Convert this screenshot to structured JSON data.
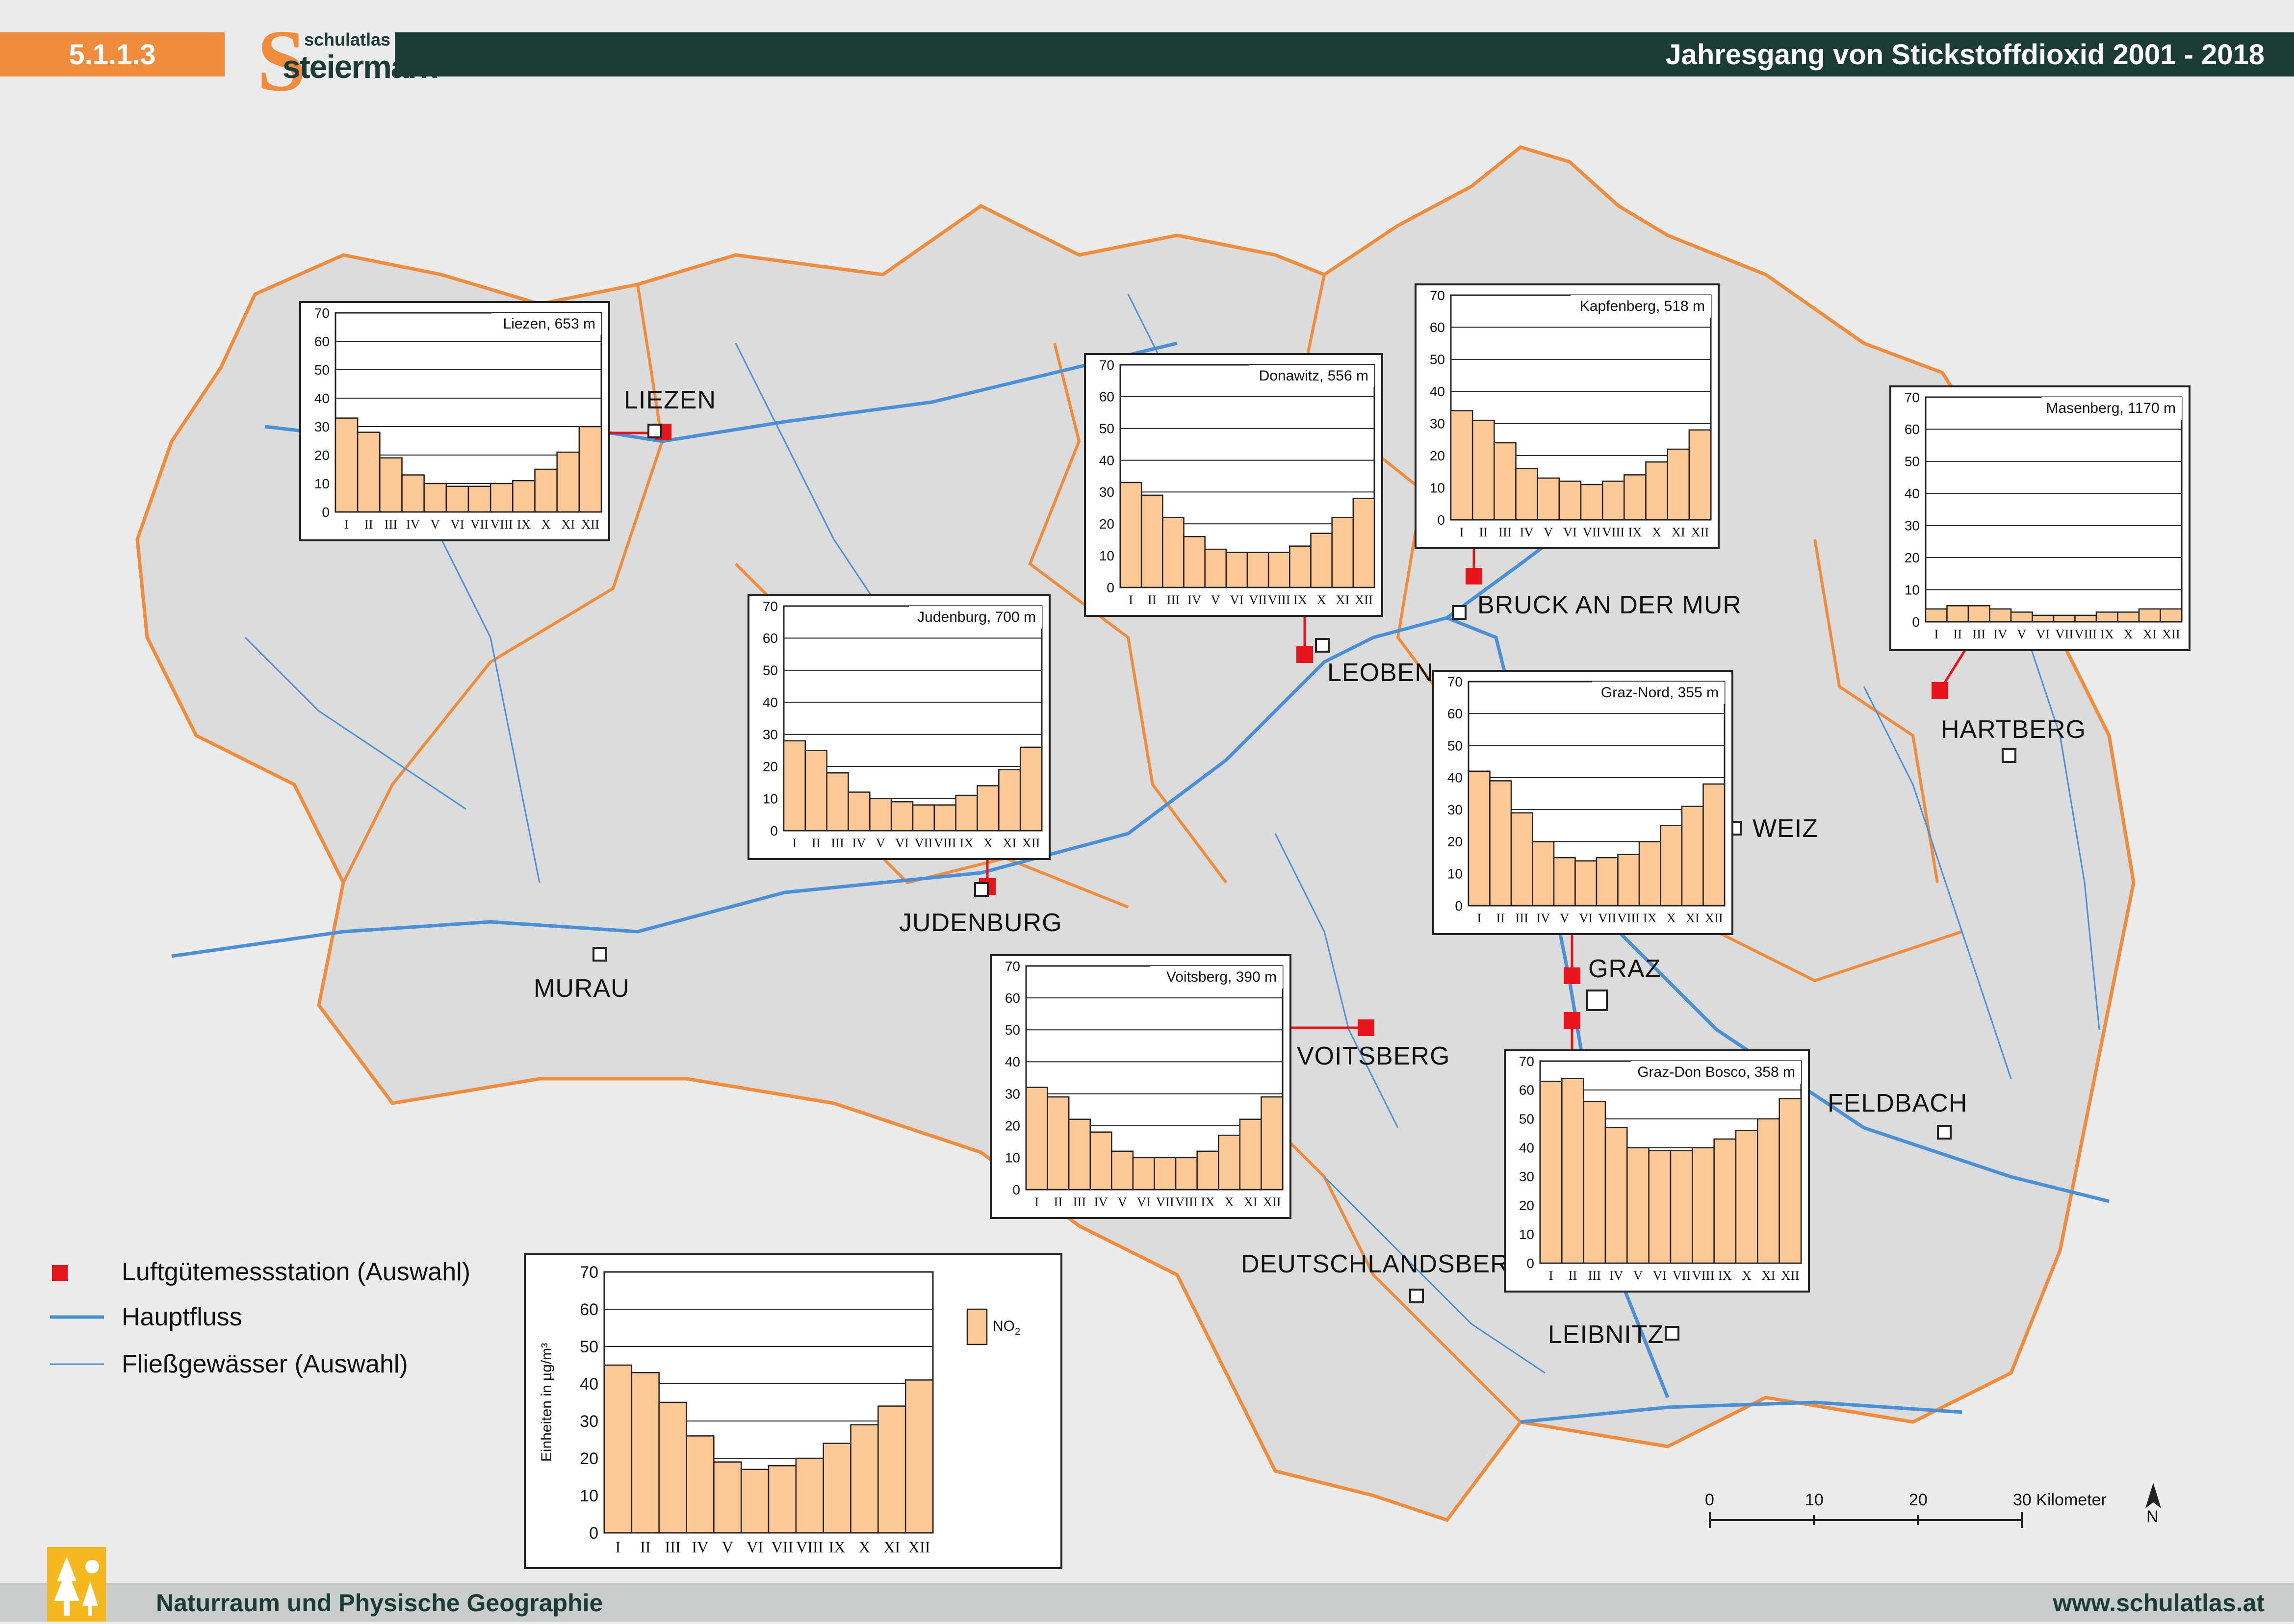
{
  "header": {
    "code": "5.1.1.3",
    "logo_small": "schulatlas",
    "logo_big": "steiermark",
    "title": "Jahresgang von Stickstoffdioxid 2001 - 2018"
  },
  "footer": {
    "left": "Naturraum und Physische Geographie",
    "right": "www.schulatlas.at"
  },
  "colors": {
    "header_orange": "#f08c3c",
    "header_dark": "#1a3c34",
    "bar_fill": "#fbc896",
    "bar_stroke": "#222222",
    "station_red": "#e8141c",
    "river_blue": "#4a90d9",
    "border_orange": "#f08c3c"
  },
  "places": {
    "liezen": "LIEZEN",
    "bruck": "BRUCK AN DER MUR",
    "leoben": "LEOBEN",
    "hartberg": "HARTBERG",
    "weiz": "WEIZ",
    "judenburg": "JUDENBURG",
    "murau": "MURAU",
    "graz": "GRAZ",
    "voitsberg": "VOITSBERG",
    "feldbach": "FELDBACH",
    "deutschlandsberg": "DEUTSCHLANDSBERG",
    "leibnitz": "LEIBNITZ"
  },
  "legend": {
    "station": "Luftgütemessstation (Auswahl)",
    "main_river": "Hauptfluss",
    "streams": "Fließgewässer (Auswahl)",
    "series_label": "NO",
    "series_sub": "2",
    "ylabel": "Einheiten in µg/m³"
  },
  "scale": {
    "ticks": [
      "0",
      "10",
      "20",
      "30 Kilometer"
    ],
    "north": "N"
  },
  "chart_data": [
    {
      "type": "bar",
      "title": "Liezen, 653 m",
      "categories": [
        "I",
        "II",
        "III",
        "IV",
        "V",
        "VI",
        "VII",
        "VIII",
        "IX",
        "X",
        "XI",
        "XII"
      ],
      "values": [
        33,
        28,
        19,
        13,
        10,
        9,
        9,
        10,
        11,
        15,
        21,
        30
      ],
      "ylim": [
        0,
        70
      ],
      "yticks": [
        "0",
        "10",
        "20",
        "30",
        "40",
        "50",
        "60",
        "70"
      ]
    },
    {
      "type": "bar",
      "title": "Donawitz, 556 m",
      "categories": [
        "I",
        "II",
        "III",
        "IV",
        "V",
        "VI",
        "VII",
        "VIII",
        "IX",
        "X",
        "XI",
        "XII"
      ],
      "values": [
        33,
        29,
        22,
        16,
        12,
        11,
        11,
        11,
        13,
        17,
        22,
        28
      ],
      "ylim": [
        0,
        70
      ],
      "yticks": [
        "0",
        "10",
        "20",
        "30",
        "40",
        "50",
        "60",
        "70"
      ]
    },
    {
      "type": "bar",
      "title": "Kapfenberg, 518 m",
      "categories": [
        "I",
        "II",
        "III",
        "IV",
        "V",
        "VI",
        "VII",
        "VIII",
        "IX",
        "X",
        "XI",
        "XII"
      ],
      "values": [
        34,
        31,
        24,
        16,
        13,
        12,
        11,
        12,
        14,
        18,
        22,
        28
      ],
      "ylim": [
        0,
        70
      ],
      "yticks": [
        "0",
        "10",
        "20",
        "30",
        "40",
        "50",
        "60",
        "70"
      ]
    },
    {
      "type": "bar",
      "title": "Masenberg, 1170 m",
      "categories": [
        "I",
        "II",
        "III",
        "IV",
        "V",
        "VI",
        "VII",
        "VIII",
        "IX",
        "X",
        "XI",
        "XII"
      ],
      "values": [
        4,
        5,
        5,
        4,
        3,
        2,
        2,
        2,
        3,
        3,
        4,
        4
      ],
      "ylim": [
        0,
        70
      ],
      "yticks": [
        "0",
        "10",
        "20",
        "30",
        "40",
        "50",
        "60",
        "70"
      ]
    },
    {
      "type": "bar",
      "title": "Judenburg, 700 m",
      "categories": [
        "I",
        "II",
        "III",
        "IV",
        "V",
        "VI",
        "VII",
        "VIII",
        "IX",
        "X",
        "XI",
        "XII"
      ],
      "values": [
        28,
        25,
        18,
        12,
        10,
        9,
        8,
        8,
        11,
        14,
        19,
        26
      ],
      "ylim": [
        0,
        70
      ],
      "yticks": [
        "0",
        "10",
        "20",
        "30",
        "40",
        "50",
        "60",
        "70"
      ]
    },
    {
      "type": "bar",
      "title": "Graz-Nord, 355 m",
      "categories": [
        "I",
        "II",
        "III",
        "IV",
        "V",
        "VI",
        "VII",
        "VIII",
        "IX",
        "X",
        "XI",
        "XII"
      ],
      "values": [
        42,
        39,
        29,
        20,
        15,
        14,
        15,
        16,
        20,
        25,
        31,
        38
      ],
      "ylim": [
        0,
        70
      ],
      "yticks": [
        "0",
        "10",
        "20",
        "30",
        "40",
        "50",
        "60",
        "70"
      ]
    },
    {
      "type": "bar",
      "title": "Voitsberg, 390 m",
      "categories": [
        "I",
        "II",
        "III",
        "IV",
        "V",
        "VI",
        "VII",
        "VIII",
        "IX",
        "X",
        "XI",
        "XII"
      ],
      "values": [
        32,
        29,
        22,
        18,
        12,
        10,
        10,
        10,
        12,
        17,
        22,
        29
      ],
      "ylim": [
        0,
        70
      ],
      "yticks": [
        "0",
        "10",
        "20",
        "30",
        "40",
        "50",
        "60",
        "70"
      ]
    },
    {
      "type": "bar",
      "title": "Graz-Don Bosco, 358 m",
      "categories": [
        "I",
        "II",
        "III",
        "IV",
        "V",
        "VI",
        "VII",
        "VIII",
        "IX",
        "X",
        "XI",
        "XII"
      ],
      "values": [
        63,
        64,
        56,
        47,
        40,
        39,
        39,
        40,
        43,
        46,
        50,
        57
      ],
      "ylim": [
        0,
        70
      ],
      "yticks": [
        "0",
        "10",
        "20",
        "30",
        "40",
        "50",
        "60",
        "70"
      ]
    },
    {
      "type": "bar",
      "title": "",
      "categories": [
        "I",
        "II",
        "III",
        "IV",
        "V",
        "VI",
        "VII",
        "VIII",
        "IX",
        "X",
        "XI",
        "XII"
      ],
      "values": [
        45,
        43,
        35,
        26,
        19,
        17,
        18,
        20,
        24,
        29,
        34,
        41
      ],
      "ylim": [
        0,
        70
      ],
      "yticks": [
        "0",
        "10",
        "20",
        "30",
        "40",
        "50",
        "60",
        "70"
      ]
    }
  ]
}
